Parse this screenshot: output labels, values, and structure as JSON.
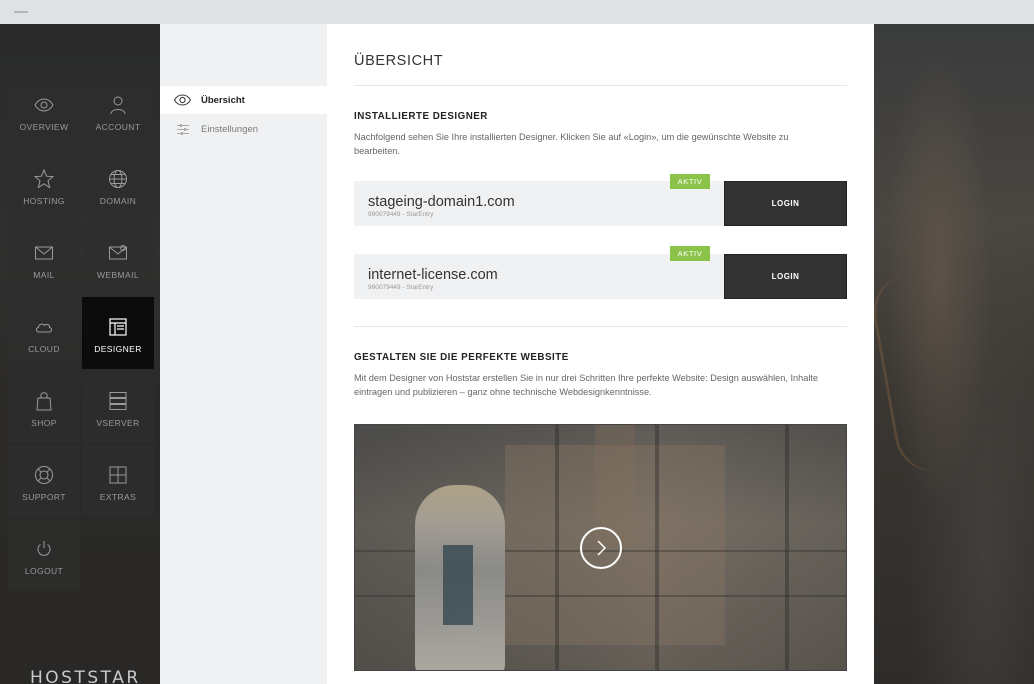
{
  "nav": {
    "items": [
      {
        "label": "OVERVIEW",
        "icon": "eye-icon"
      },
      {
        "label": "ACCOUNT",
        "icon": "user-icon"
      },
      {
        "label": "HOSTING",
        "icon": "star-icon"
      },
      {
        "label": "DOMAIN",
        "icon": "globe-icon"
      },
      {
        "label": "MAIL",
        "icon": "envelope-icon"
      },
      {
        "label": "WEBMAIL",
        "icon": "webmail-icon"
      },
      {
        "label": "CLOUD",
        "icon": "cloud-icon"
      },
      {
        "label": "DESIGNER",
        "icon": "layout-icon"
      },
      {
        "label": "SHOP",
        "icon": "bag-icon"
      },
      {
        "label": "VSERVER",
        "icon": "server-icon"
      },
      {
        "label": "SUPPORT",
        "icon": "lifebuoy-icon"
      },
      {
        "label": "EXTRAS",
        "icon": "grid-icon"
      },
      {
        "label": "LOGOUT",
        "icon": "power-icon"
      }
    ],
    "active": "DESIGNER",
    "logo": "HOSTSTAR"
  },
  "subnav": {
    "items": [
      {
        "label": "Übersicht",
        "icon": "eye-icon"
      },
      {
        "label": "Einstellungen",
        "icon": "sliders-icon"
      }
    ]
  },
  "main": {
    "title": "ÜBERSICHT",
    "installed": {
      "heading": "INSTALLIERTE DESIGNER",
      "text": "Nachfolgend sehen Sie Ihre installierten Designer. Klicken Sie auf «Login», um die gewünschte Website zu bearbeiten.",
      "sites": [
        {
          "name": "stageing-domain1.com",
          "sub": "990079449 - StarEntry",
          "badge": "AKTIV",
          "button": "LOGIN"
        },
        {
          "name": "internet-license.com",
          "sub": "990079449 - StarEntry",
          "badge": "AKTIV",
          "button": "LOGIN"
        }
      ]
    },
    "promo": {
      "heading": "GESTALTEN SIE DIE PERFEKTE WEBSITE",
      "text": "Mit dem Designer von Hoststar erstellen Sie in nur drei Schritten Ihre perfekte Website: Design auswählen, Inhalte eintragen und publizieren – ganz ohne technische Webdesignkenntnisse."
    }
  },
  "colors": {
    "badge": "#8bc34a",
    "login_button": "#333333",
    "active_tile": "#0c0c0c"
  }
}
